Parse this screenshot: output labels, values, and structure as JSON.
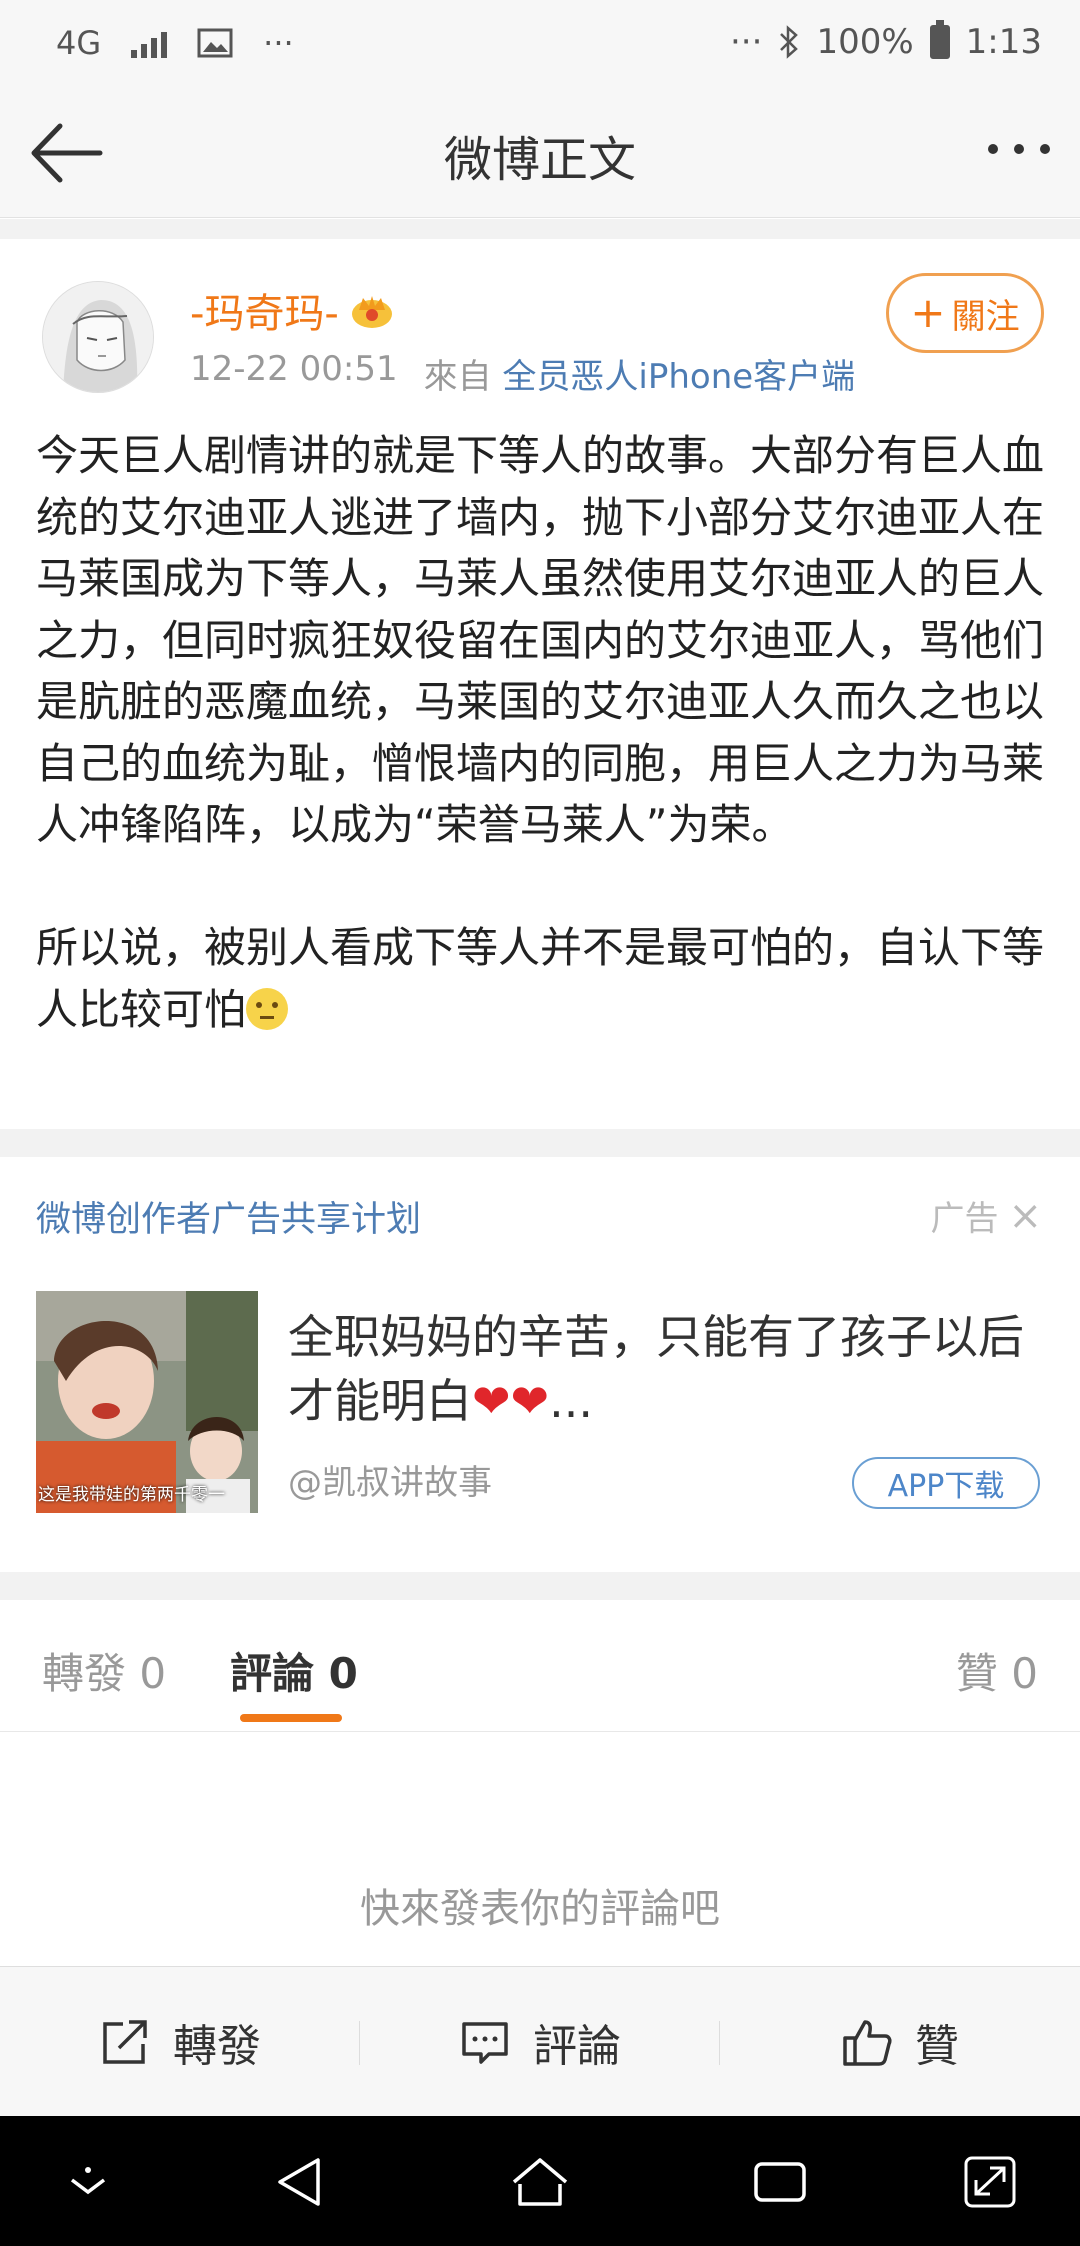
{
  "status_bar": {
    "network": "4G",
    "more": "···",
    "right_more": "···",
    "battery": "100%",
    "time": "1:13"
  },
  "nav": {
    "title": "微博正文",
    "back_icon": "back-arrow-icon",
    "more_icon": "more-dots-icon"
  },
  "post": {
    "username": "-玛奇玛-",
    "vip_icon": "crown-icon",
    "time": "12-22 00:51",
    "from_label": "來自",
    "source": "全员恶人iPhone客户端",
    "follow_label": "關注",
    "follow_plus": "+",
    "paragraph1": "今天巨人剧情讲的就是下等人的故事。大部分有巨人血统的艾尔迪亚人逃进了墙内，抛下小部分艾尔迪亚人在马莱国成为下等人，马莱人虽然使用艾尔迪亚人的巨人之力，但同时疯狂奴役留在国内的艾尔迪亚人，骂他们是肮脏的恶魔血统，马莱国的艾尔迪亚人久而久之也以自己的血统为耻，憎恨墙内的同胞，用巨人之力为马莱人冲锋陷阵，以成为“荣誉马莱人”为荣。",
    "paragraph2": "所以说，被别人看成下等人并不是最可怕的，自认下等人比较可怕"
  },
  "ad": {
    "program": "微博创作者广告共享计划",
    "label": "广告",
    "close": "×",
    "headline": "全职妈妈的辛苦，只能有了孩子以后才能明白",
    "hearts": "❤❤",
    "ellipsis": "...",
    "author": "@凯叔讲故事",
    "button": "APP下载",
    "thumb_caption": "这是我带娃的第两千零一"
  },
  "tabs": {
    "repost_label": "轉發",
    "repost_count": "0",
    "comment_label": "評論",
    "comment_count": "0",
    "like_label": "贊",
    "like_count": "0"
  },
  "empty_hint": "快來發表你的評論吧",
  "toolbar": {
    "repost": "轉發",
    "comment": "評論",
    "like": "贊"
  },
  "colors": {
    "accent_orange": "#f07818",
    "link_blue": "#4d7cb3"
  }
}
